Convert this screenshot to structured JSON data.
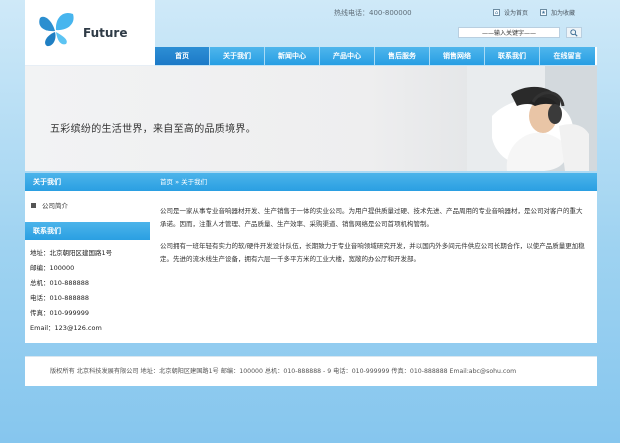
{
  "header": {
    "logo_text": "Future",
    "hotline": "热线电话：400-800000",
    "links": [
      {
        "label": "设为首页"
      },
      {
        "label": "加为收藏"
      }
    ],
    "search": {
      "value": "——输入关键字——"
    }
  },
  "nav": {
    "items": [
      {
        "label": "首页"
      },
      {
        "label": "关于我们"
      },
      {
        "label": "新闻中心"
      },
      {
        "label": "产品中心"
      },
      {
        "label": "售后服务"
      },
      {
        "label": "销售网络"
      },
      {
        "label": "联系我们"
      },
      {
        "label": "在线留言"
      }
    ]
  },
  "banner": {
    "slogan": "五彩缤纷的生活世界，来自至高的品质境界。"
  },
  "sidebar": {
    "about_title": "关于我们",
    "about_items": [
      {
        "label": "公司简介"
      }
    ],
    "contact_title": "联系我们",
    "contact_lines": [
      "地址：北京朝阳区建国路1号",
      "邮编：100000",
      "总机：010-888888",
      "电话：010-888888",
      "传真：010-999999",
      "Email：123@126.com"
    ]
  },
  "main": {
    "breadcrumb": {
      "home": "首页",
      "sep": " » ",
      "current": "关于我们"
    },
    "paragraphs": [
      "公司是一家从事专业音响器材开发、生产销售于一体的实业公司。为用户提供质量过硬、技术先进、产品周用的专业音响器材，是公司对客户的重大承诺。因而，注重人才管理、产品质量、生产效率、采购渠道、销售网络是公司首项机构管制。",
      "公司拥有一班年轻有实力的软/硬件开发设计队伍，长期致力于专业音响领域研究开发，并以国内外多间元件供应公司长期合作，以使产品质量更加稳定。先进的流水线生产设备，拥有六层一千多平方米的工业大楼，宽敞的办公厅和开发部。"
    ]
  },
  "footer": {
    "text": "版权所有  北京科技发展有限公司 地址：北京朝阳区建国路1号 邮编：100000   总机：010-888888 - 9 电话：010-999999 传真：010-888888 Email:abc@sohu.com"
  },
  "colors": {
    "nav_blue": "#279ee3",
    "nav_active": "#1c79c7",
    "page_bg": "#9fd3f1"
  }
}
